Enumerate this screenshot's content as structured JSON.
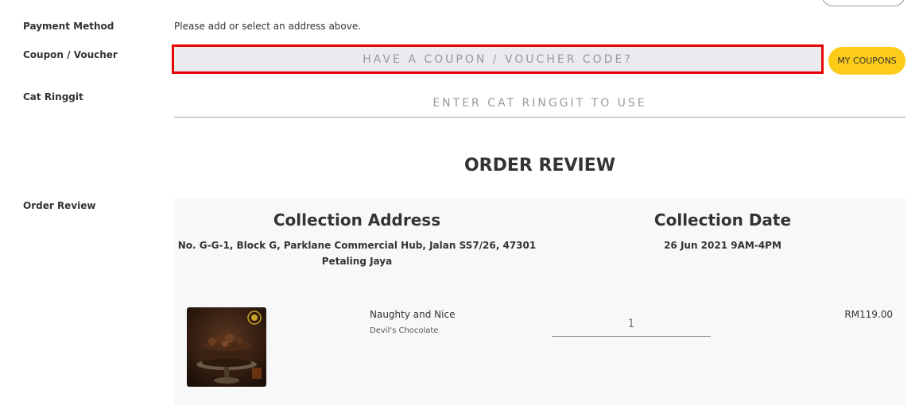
{
  "payment": {
    "label": "Payment Method",
    "message": "Please add or select an address above."
  },
  "coupon": {
    "label": "Coupon / Voucher",
    "placeholder": "HAVE A COUPON / VOUCHER CODE?",
    "my_coupons_label": "MY COUPONS",
    "highlight_color": "#e60000",
    "button_color": "#fccc18"
  },
  "cat_ringgit": {
    "label": "Cat Ringgit",
    "placeholder": "ENTER CAT RINGGIT TO USE"
  },
  "order_review": {
    "heading": "ORDER REVIEW",
    "label": "Order Review",
    "collection_address_title": "Collection Address",
    "collection_address_line1": "No. G-G-1, Block G, Parklane Commercial Hub, Jalan SS7/26, 47301",
    "collection_address_line2": "Petaling Jaya",
    "collection_date_title": "Collection Date",
    "collection_date": "26 Jun 2021 9AM-4PM",
    "items": [
      {
        "name": "Naughty and Nice",
        "variant": "Devil's Chocolate",
        "quantity": "1",
        "price": "RM119.00",
        "image": "chocolate-cake-image"
      }
    ]
  }
}
